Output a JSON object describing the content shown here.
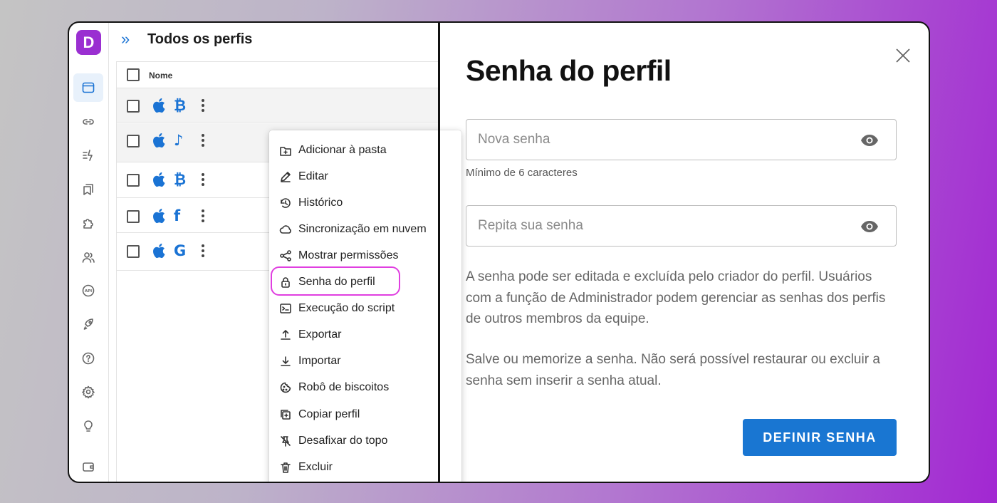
{
  "app": {
    "logo_letter": "D",
    "brand_color": "#9a2fd1"
  },
  "header": {
    "expand_glyph": "»",
    "title": "Todos os perfis"
  },
  "table": {
    "column_name": "Nome",
    "rows": [
      {
        "os": "apple-icon",
        "service": "bitcoin-icon",
        "service_glyph": "₿",
        "highlighted": true
      },
      {
        "os": "apple-icon",
        "service": "tiktok-icon",
        "service_glyph": "♪",
        "highlighted": true
      },
      {
        "os": "apple-icon",
        "service": "bitcoin-icon",
        "service_glyph": "₿",
        "highlighted": false
      },
      {
        "os": "apple-icon",
        "service": "facebook-icon",
        "service_glyph": "f",
        "highlighted": false
      },
      {
        "os": "apple-icon",
        "service": "google-icon",
        "service_glyph": "G",
        "highlighted": false
      }
    ]
  },
  "context_menu": {
    "items": [
      {
        "label": "Adicionar à pasta",
        "icon": "folder-plus-icon"
      },
      {
        "label": "Editar",
        "icon": "edit-icon"
      },
      {
        "label": "Histórico",
        "icon": "history-icon"
      },
      {
        "label": "Sincronização em nuvem",
        "icon": "cloud-icon"
      },
      {
        "label": "Mostrar permissões",
        "icon": "share-icon"
      },
      {
        "label": "Senha do perfil",
        "icon": "lock-icon"
      },
      {
        "label": "Execução do script",
        "icon": "terminal-icon"
      },
      {
        "label": "Exportar",
        "icon": "upload-icon"
      },
      {
        "label": "Importar",
        "icon": "download-icon"
      },
      {
        "label": "Robô de biscoitos",
        "icon": "cookie-icon"
      },
      {
        "label": "Copiar perfil",
        "icon": "copy-icon"
      },
      {
        "label": "Desafixar do topo",
        "icon": "unpin-icon"
      },
      {
        "label": "Excluir",
        "icon": "trash-icon"
      }
    ],
    "highlighted_item": "Senha do perfil",
    "highlight_color": "#e03fe0"
  },
  "dialog": {
    "title": "Senha do perfil",
    "new_password_placeholder": "Nova senha",
    "new_password_value": "",
    "helper": "Mínimo de 6 caracteres",
    "repeat_password_placeholder": "Repita sua senha",
    "repeat_password_value": "",
    "paragraph1": "A senha pode ser editada e excluída pelo criador do perfil. Usuários com a função de Administrador podem gerenciar as senhas dos perfis de outros membros da equipe.",
    "paragraph2": "Salve ou memorize a senha. Não será possível restaurar ou excluir a senha sem inserir a senha atual.",
    "submit_label": "DEFINIR SENHA",
    "accent_color": "#1976d2"
  }
}
